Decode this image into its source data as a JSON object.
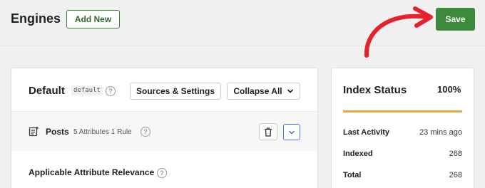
{
  "header": {
    "title": "Engines",
    "add_new_label": "Add New",
    "save_label": "Save"
  },
  "engine": {
    "name": "Default",
    "slug": "default",
    "help": "?",
    "sources_settings_label": "Sources & Settings",
    "collapse_all_label": "Collapse All",
    "source": {
      "label": "Posts",
      "meta": "5 Attributes 1 Rule"
    },
    "relevance_label": "Applicable Attribute Relevance"
  },
  "index_status": {
    "title": "Index Status",
    "percent_label": "100%",
    "progress": 1.0,
    "rows": [
      {
        "label": "Last Activity",
        "value": "23 mins ago"
      },
      {
        "label": "Indexed",
        "value": "268"
      },
      {
        "label": "Total",
        "value": "268"
      }
    ]
  },
  "colors": {
    "accent_green": "#3d8a3d",
    "progress_orange": "#e8a642",
    "annotation_red": "#e8202c"
  }
}
